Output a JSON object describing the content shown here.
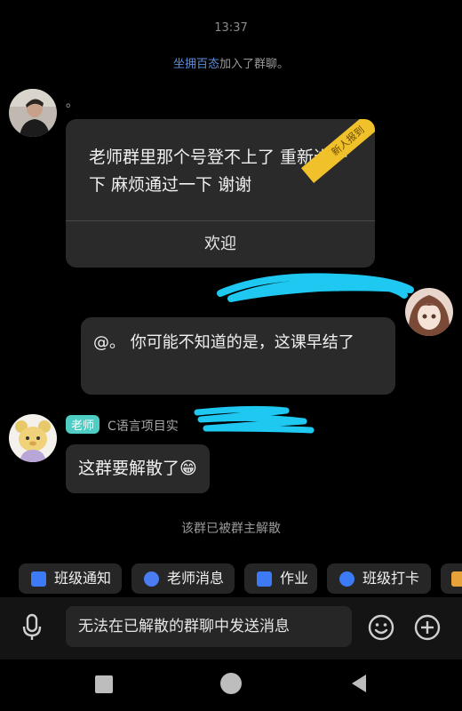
{
  "status": {
    "time": "13:37"
  },
  "system_join": {
    "who": "坐拥百态",
    "text": "加入了群聊。"
  },
  "newcomer": {
    "name": "。",
    "message": "老师群里那个号登不上了 重新进一下 麻烦通过一下 谢谢",
    "ribbon": "新人报到",
    "welcome_button": "欢迎"
  },
  "reply": {
    "text": "@。 你可能不知道的是，这课早结了"
  },
  "teacher": {
    "tag": "老师",
    "sender_prefix": "C语言项目实",
    "message": "这群要解散了😁"
  },
  "system_dissolved": {
    "text": "该群已被群主解散"
  },
  "quick_bar": {
    "items": [
      {
        "label": "班级通知",
        "icon": "notice-icon",
        "color": "#3d7bf6"
      },
      {
        "label": "老师消息",
        "icon": "teacher-message-icon",
        "color": "#4a7df2"
      },
      {
        "label": "作业",
        "icon": "homework-icon",
        "color": "#3d7bf6"
      },
      {
        "label": "班级打卡",
        "icon": "checkin-icon",
        "color": "#3d7bf6"
      }
    ]
  },
  "input": {
    "placeholder": "无法在已解散的群聊中发送消息"
  },
  "colors": {
    "accent": "#5b8fe0",
    "teacher_tag": "#4ecdc4",
    "ribbon": "#f0c12a",
    "scribble": "#1ec8f0"
  }
}
